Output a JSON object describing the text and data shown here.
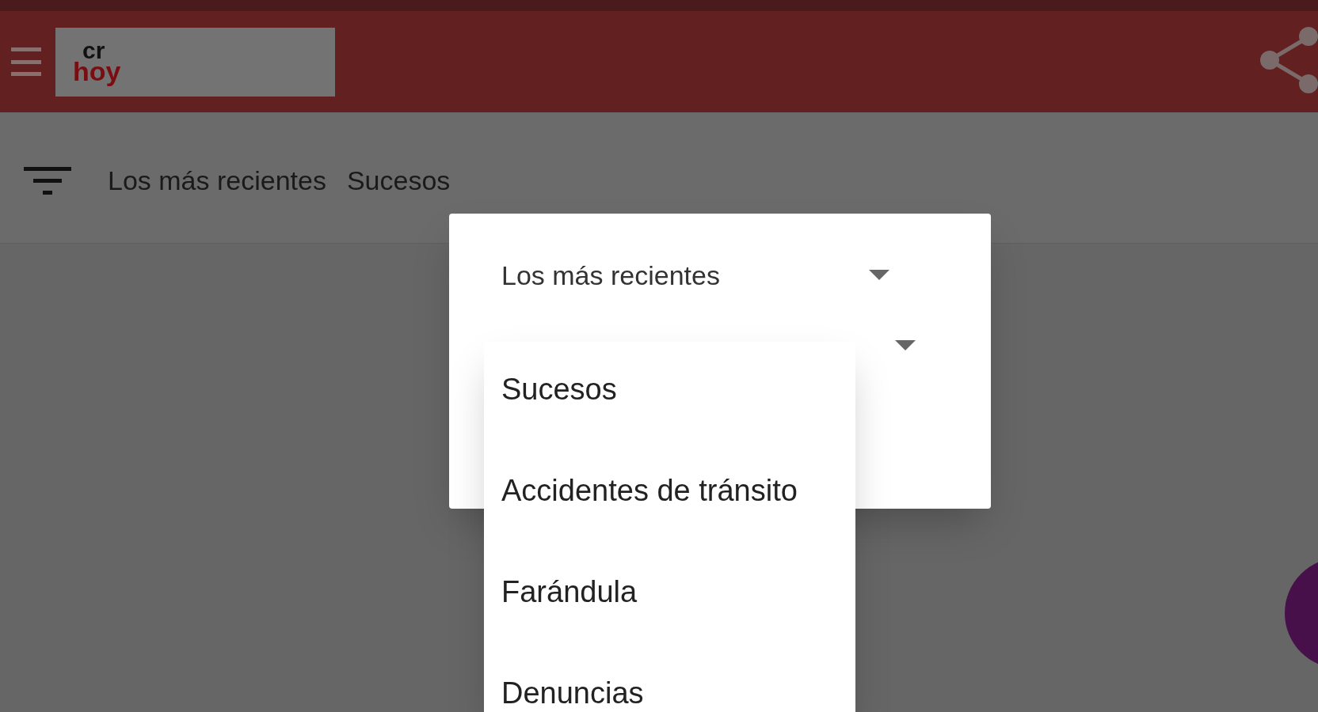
{
  "header": {
    "logo": {
      "line_1": "cr",
      "line_2": "hoy"
    }
  },
  "filter_bar": {
    "order": "Los más recientes",
    "category": "Sucesos"
  },
  "dialog": {
    "order_select": {
      "value": "Los más recientes"
    }
  },
  "category_menu": {
    "items": [
      {
        "label": "Sucesos",
        "selected": false
      },
      {
        "label": "Accidentes de tránsito",
        "selected": false
      },
      {
        "label": "Farándula",
        "selected": false
      },
      {
        "label": "Denuncias",
        "selected": false
      }
    ]
  }
}
